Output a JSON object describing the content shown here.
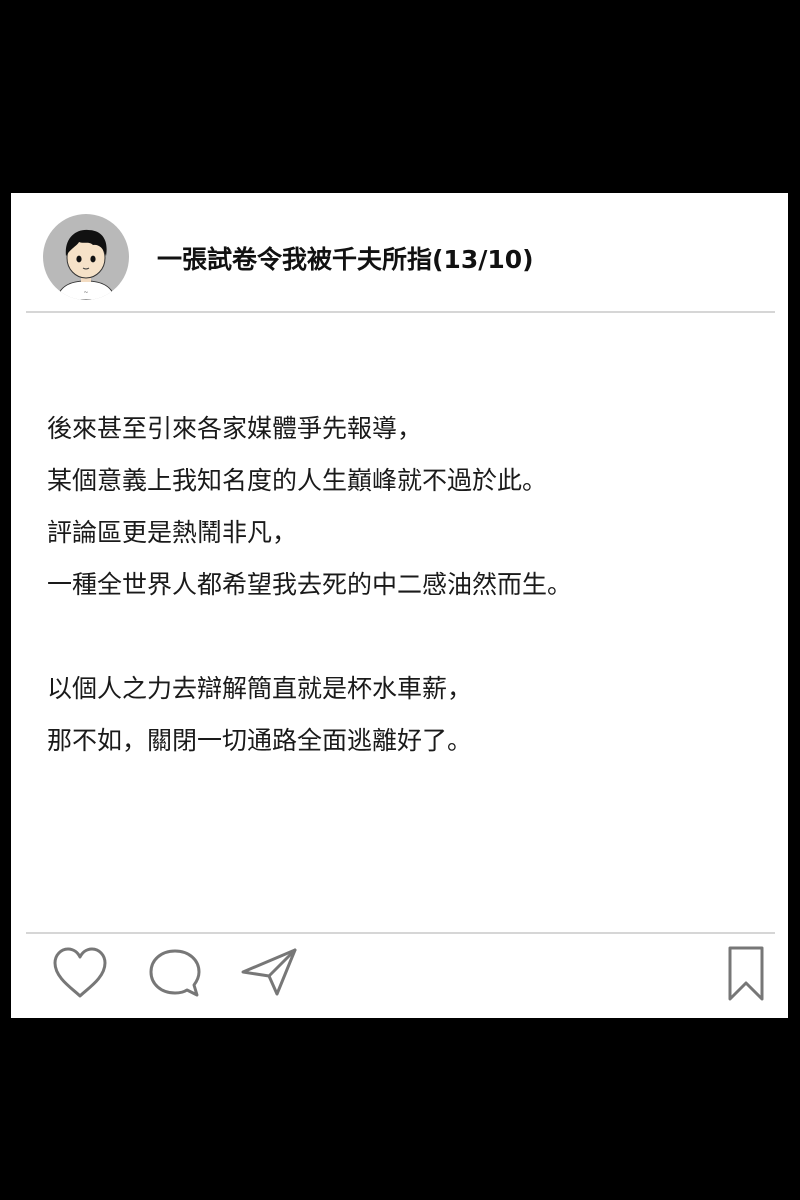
{
  "post": {
    "title": "一張試卷令我被千夫所指(13/10)",
    "avatar_icon": "cartoon-boy-avatar",
    "paragraphs": [
      {
        "lines": [
          "後來甚至引來各家媒體爭先報導，",
          "某個意義上我知名度的人生巔峰就不過於此。",
          "評論區更是熱鬧非凡，",
          "一種全世界人都希望我去死的中二感油然而生。"
        ]
      },
      {
        "lines": [
          "以個人之力去辯解簡直就是杯水車薪，",
          "那不如，關閉一切通路全面逃離好了。"
        ]
      }
    ]
  },
  "actions": {
    "like_icon": "heart-icon",
    "comment_icon": "speech-bubble-icon",
    "share_icon": "paper-plane-icon",
    "save_icon": "bookmark-icon"
  },
  "colors": {
    "page_background": "#000000",
    "card_background": "#ffffff",
    "divider": "#d6d6d6",
    "icon_stroke": "#777777",
    "avatar_background": "#b9b9b9"
  }
}
